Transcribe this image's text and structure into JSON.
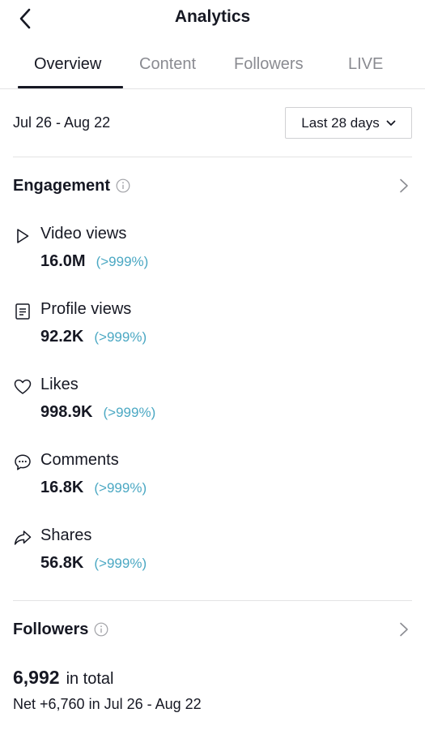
{
  "header": {
    "title": "Analytics",
    "back_icon": "chevron-left-icon"
  },
  "tabs": [
    {
      "label": "Overview",
      "active": true
    },
    {
      "label": "Content",
      "active": false
    },
    {
      "label": "Followers",
      "active": false
    },
    {
      "label": "LIVE",
      "active": false
    }
  ],
  "date_range": "Jul 26 - Aug 22",
  "period_select": {
    "selected": "Last 28 days"
  },
  "engagement": {
    "title": "Engagement",
    "metrics": [
      {
        "label": "Video views",
        "value": "16.0M",
        "change": "(>999%)",
        "icon": "play-icon"
      },
      {
        "label": "Profile views",
        "value": "92.2K",
        "change": "(>999%)",
        "icon": "document-icon"
      },
      {
        "label": "Likes",
        "value": "998.9K",
        "change": "(>999%)",
        "icon": "heart-icon"
      },
      {
        "label": "Comments",
        "value": "16.8K",
        "change": "(>999%)",
        "icon": "comment-icon"
      },
      {
        "label": "Shares",
        "value": "56.8K",
        "change": "(>999%)",
        "icon": "share-icon"
      }
    ]
  },
  "followers": {
    "title": "Followers",
    "total": "6,992",
    "total_suffix": "in total",
    "net": "Net +6,760 in Jul 26 - Aug 22"
  },
  "colors": {
    "accent_change": "#4ba8c3",
    "text": "#161823",
    "muted": "#8a8b91"
  }
}
